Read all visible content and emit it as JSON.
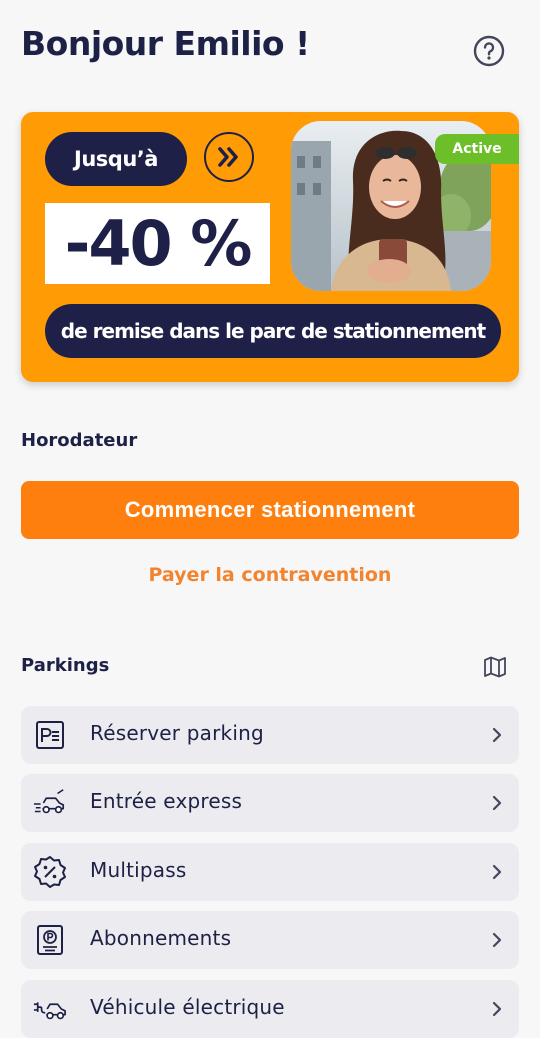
{
  "header": {
    "greeting": "Bonjour Emilio !",
    "help_icon": "help-circle-icon"
  },
  "banner": {
    "upto_label": "Jusqu’à",
    "discount": "-40 %",
    "description": "de remise dans le parc de stationnement",
    "status_badge": "Active",
    "arrow_icon": "double-chevron-right-icon",
    "background_color": "#ff9c05",
    "dark_color": "#1f2048",
    "badge_color": "#6dbf2a"
  },
  "horodateur": {
    "title": "Horodateur",
    "start_button": "Commencer stationnement",
    "pay_fine_link": "Payer la contravention",
    "accent_color": "#ff7f0e"
  },
  "parkings": {
    "title": "Parkings",
    "map_icon": "map-icon",
    "items": [
      {
        "label": "Réserver parking",
        "icon": "parking-ticket-icon"
      },
      {
        "label": "Entrée express",
        "icon": "fast-car-icon"
      },
      {
        "label": "Multipass",
        "icon": "percent-badge-icon"
      },
      {
        "label": "Abonnements",
        "icon": "parking-card-icon"
      },
      {
        "label": "Véhicule électrique",
        "icon": "electric-car-icon"
      }
    ]
  }
}
